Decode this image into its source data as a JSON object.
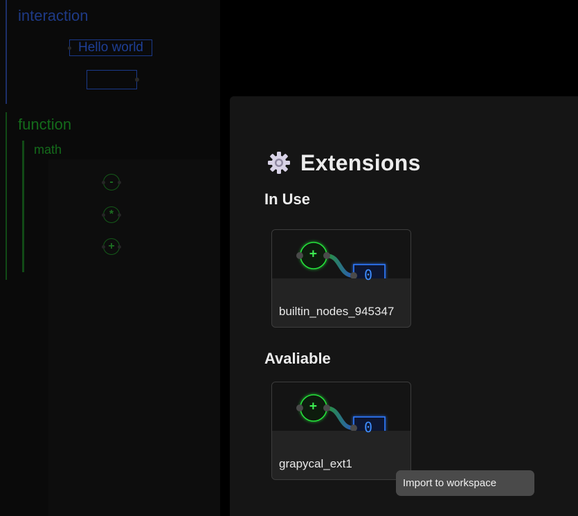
{
  "workspace": {
    "sections": [
      {
        "title": "interaction",
        "nodes": [
          {
            "type": "text",
            "value": "Hello world"
          },
          {
            "type": "text",
            "value": ""
          }
        ]
      },
      {
        "title": "function",
        "subsections": [
          {
            "title": "math",
            "operators": [
              "-",
              "*",
              "+"
            ]
          }
        ]
      }
    ]
  },
  "modal": {
    "title": "Extensions",
    "title_icon": "gear-icon",
    "in_use": {
      "heading": "In Use",
      "extensions": [
        {
          "name": "builtin_nodes_945347",
          "preview": {
            "operator": "+",
            "output": "0"
          }
        }
      ]
    },
    "available": {
      "heading": "Avaliable",
      "extensions": [
        {
          "name": "grapycal_ext1",
          "preview": {
            "operator": "+",
            "output": "0"
          }
        }
      ]
    },
    "tooltip": "Import to workspace"
  },
  "colors": {
    "interaction_accent": "#1e3a86",
    "function_accent": "#146b1b",
    "preview_green": "#22d63a",
    "preview_blue": "#2f7bff"
  }
}
